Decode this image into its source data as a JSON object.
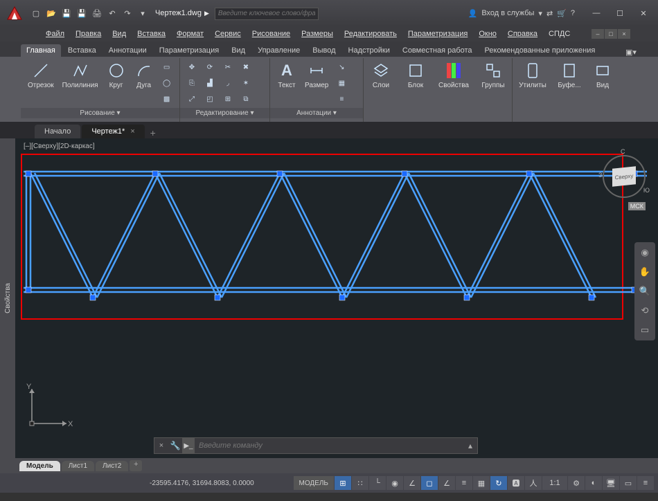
{
  "titlebar": {
    "doc_title": "Чертеж1.dwg",
    "search_placeholder": "Введите ключевое слово/фразу",
    "signin": "Вход в службы"
  },
  "menubar": {
    "items": [
      "Файл",
      "Правка",
      "Вид",
      "Вставка",
      "Формат",
      "Сервис",
      "Рисование",
      "Размеры",
      "Редактировать",
      "Параметризация",
      "Окно",
      "Справка",
      "СПДС"
    ]
  },
  "ribbon_tabs": [
    "Главная",
    "Вставка",
    "Аннотации",
    "Параметризация",
    "Вид",
    "Управление",
    "Вывод",
    "Надстройки",
    "Совместная работа",
    "Рекомендованные приложения"
  ],
  "ribbon": {
    "draw": {
      "name": "Рисование ▾",
      "line": "Отрезок",
      "polyline": "Полилиния",
      "circle": "Круг",
      "arc": "Дуга"
    },
    "edit": {
      "name": "Редактирование ▾"
    },
    "annot": {
      "name": "Аннотации ▾",
      "text": "Текст",
      "dim": "Размер"
    },
    "layers": {
      "layer": "Слои"
    },
    "block": {
      "block": "Блок"
    },
    "props": {
      "props": "Свойства"
    },
    "groups": {
      "groups": "Группы"
    },
    "utils": {
      "utils": "Утилиты"
    },
    "clip": {
      "clip": "Буфе..."
    },
    "view": {
      "view": "Вид"
    }
  },
  "drawing_tabs": {
    "start": "Начало",
    "active": "Чертеж1*"
  },
  "canvas": {
    "view_label": "[–][Сверху][2D-каркас]",
    "navcube": "Сверху",
    "wcs": "МСК",
    "compass_s": "С",
    "compass_w": "З",
    "compass_e": "Ю",
    "ucs_x": "X",
    "ucs_y": "Y"
  },
  "cmdline": {
    "placeholder": "Введите команду"
  },
  "layout_tabs": {
    "model": "Модель",
    "sheet1": "Лист1",
    "sheet2": "Лист2"
  },
  "status": {
    "coords": "-23595.4176, 31694.8083, 0.0000",
    "model": "МОДЕЛЬ",
    "scale": "1:1"
  }
}
